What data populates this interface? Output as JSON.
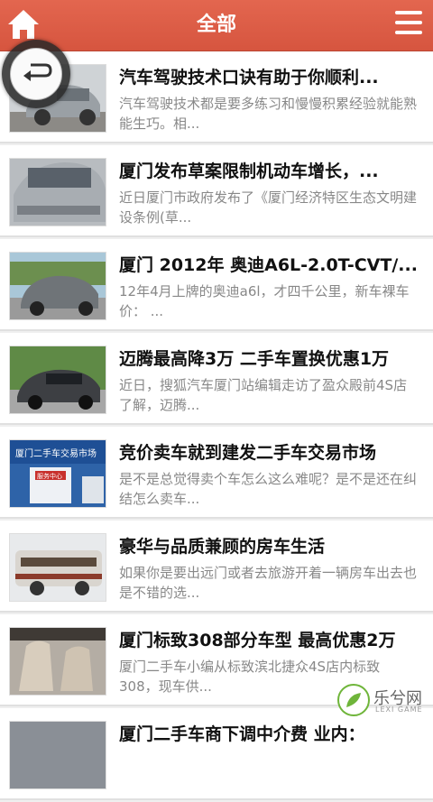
{
  "header": {
    "title": "全部",
    "home_icon": "home-icon",
    "menu_icon": "menu-icon",
    "color": "#d85a44"
  },
  "articles": [
    {
      "title": "汽车驾驶技术口诀有助于你顺利...",
      "desc": "汽车驾驶技术都是要多练习和慢慢积累经验就能熟能生巧。相..."
    },
    {
      "title": "厦门发布草案限制机动车增长，...",
      "desc": "近日厦门市政府发布了《厦门经济特区生态文明建设条例(草..."
    },
    {
      "title": "厦门 2012年 奥迪A6L-2.0T-CVT/...",
      "desc": "12年4月上牌的奥迪a6l，才四千公里，新车裸车价： ..."
    },
    {
      "title": "迈腾最高降3万 二手车置换优惠1万",
      "desc": "近日，搜狐汽车厦门站编辑走访了盈众殿前4S店了解，迈腾..."
    },
    {
      "title": "竞价卖车就到建发二手车交易市场",
      "desc": "是不是总觉得卖个车怎么这么难呢？是不是还在纠结怎么卖车..."
    },
    {
      "title": "豪华与品质兼顾的房车生活",
      "desc": "如果你是要出远门或者去旅游开着一辆房车出去也是不错的选..."
    },
    {
      "title": "厦门标致308部分车型 最高优惠2万",
      "desc": "厦门二手车小编从标致滨北捷众4S店内标致308，现车供..."
    },
    {
      "title": "厦门二手车商下调中介费 业内：",
      "desc": ""
    }
  ],
  "thumb_texts": {
    "market_sign": "厦门二手车交易市场",
    "center_sign": "服务中心"
  },
  "overlay": {
    "back_icon": "back-arrow-icon"
  },
  "watermark": {
    "text": "乐兮网",
    "sub": "LEXI GAME"
  }
}
